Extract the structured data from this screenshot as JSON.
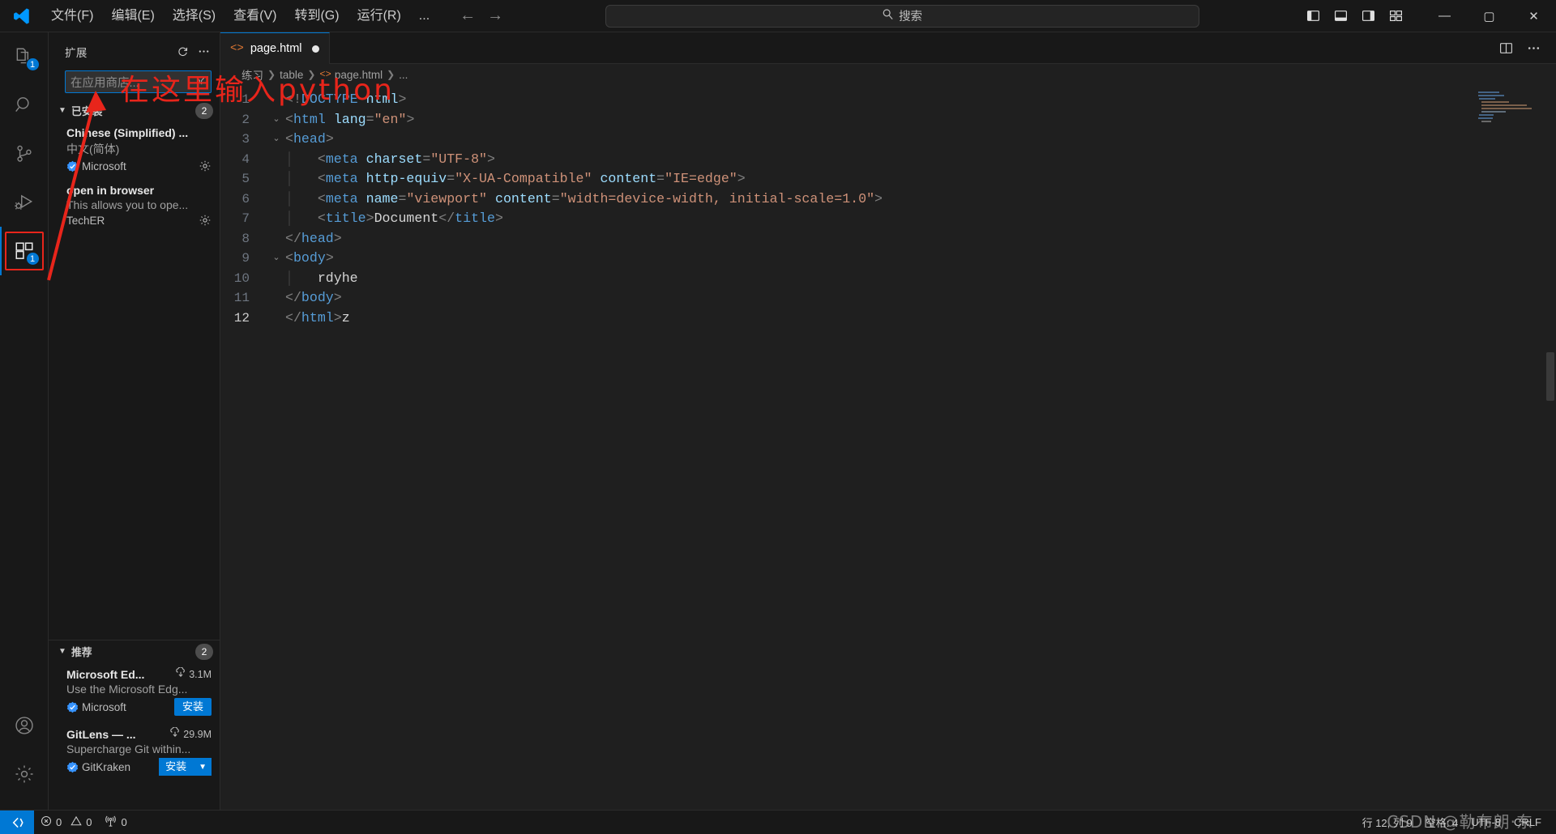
{
  "titlebar": {
    "logo_icon": "vscode-logo-icon",
    "menus": [
      "文件(F)",
      "编辑(E)",
      "选择(S)",
      "查看(V)",
      "转到(G)",
      "运行(R)",
      "..."
    ],
    "nav_back_icon": "arrow-left-icon",
    "nav_forward_icon": "arrow-right-icon",
    "search": {
      "icon": "search-icon",
      "text": "搜索",
      "value": ""
    },
    "layout_buttons": [
      {
        "name": "toggle-primary-sidebar",
        "icon": "layout-sidebar-left-icon"
      },
      {
        "name": "toggle-panel",
        "icon": "layout-panel-icon"
      },
      {
        "name": "toggle-secondary-sidebar",
        "icon": "layout-sidebar-right-icon"
      },
      {
        "name": "customize-layout",
        "icon": "layout-grid-icon"
      }
    ],
    "window_buttons": [
      {
        "name": "minimize-button",
        "glyph": "—"
      },
      {
        "name": "maximize-button",
        "glyph": "▢"
      },
      {
        "name": "close-button",
        "glyph": "✕"
      }
    ]
  },
  "activitybar": {
    "items": [
      {
        "name": "explorer",
        "icon": "files-icon",
        "badge": "1",
        "active": false
      },
      {
        "name": "search",
        "icon": "search-icon",
        "badge": "",
        "active": false
      },
      {
        "name": "source-control",
        "icon": "source-control-icon",
        "badge": "",
        "active": false
      },
      {
        "name": "run-and-debug",
        "icon": "debug-icon",
        "badge": "",
        "active": false
      },
      {
        "name": "extensions",
        "icon": "extensions-icon",
        "badge": "1",
        "active": true
      }
    ],
    "bottom": [
      {
        "name": "accounts",
        "icon": "account-icon"
      },
      {
        "name": "manage-settings",
        "icon": "gear-icon"
      }
    ]
  },
  "sidebar": {
    "title": "扩展",
    "refresh_icon": "refresh-icon",
    "more_icon": "ellipsis-icon",
    "search_placeholder": "在应用商店...",
    "search_value": "",
    "clear_icon": "clear-filter-icon",
    "sections": [
      {
        "label": "已安装",
        "count": "2",
        "expanded": true,
        "extensions": [
          {
            "name": "Chinese (Simplified) ...",
            "description": "中文(简体)",
            "publisher": "Microsoft",
            "verified": true,
            "installs": "",
            "action": "gear",
            "action_label": ""
          },
          {
            "name": "open in browser",
            "description": "This allows you to ope...",
            "publisher": "TechER",
            "verified": false,
            "installs": "",
            "action": "gear",
            "action_label": ""
          }
        ]
      },
      {
        "label": "推荐",
        "count": "2",
        "expanded": true,
        "extensions": [
          {
            "name": "Microsoft Ed...",
            "description": "Use the Microsoft Edg...",
            "publisher": "Microsoft",
            "verified": true,
            "installs": "3.1M",
            "action": "install",
            "action_label": "安装"
          },
          {
            "name": "GitLens — ...",
            "description": "Supercharge Git within...",
            "publisher": "GitKraken",
            "verified": true,
            "installs": "29.9M",
            "action": "install-split",
            "action_label": "安装"
          }
        ]
      }
    ]
  },
  "editor": {
    "tab": {
      "label": "page.html",
      "icon": "html-file-icon",
      "modified": true
    },
    "tab_actions": [
      {
        "name": "split-editor-right",
        "icon": "split-editor-icon"
      },
      {
        "name": "more-actions",
        "icon": "ellipsis-icon"
      }
    ],
    "breadcrumb": [
      "练习",
      "table",
      "page.html",
      "..."
    ],
    "code_lines": [
      {
        "n": "1",
        "fold": "",
        "indent": 0,
        "tokens": [
          {
            "c": "t-punct",
            "t": "<!"
          },
          {
            "c": "t-doctype",
            "t": "DOCTYPE"
          },
          {
            "c": "t-text",
            "t": " "
          },
          {
            "c": "t-attr",
            "t": "html"
          },
          {
            "c": "t-punct",
            "t": ">"
          }
        ]
      },
      {
        "n": "2",
        "fold": "v",
        "indent": 0,
        "tokens": [
          {
            "c": "t-punct",
            "t": "<"
          },
          {
            "c": "t-tag",
            "t": "html"
          },
          {
            "c": "t-text",
            "t": " "
          },
          {
            "c": "t-attr",
            "t": "lang"
          },
          {
            "c": "t-punct",
            "t": "="
          },
          {
            "c": "t-str",
            "t": "\"en\""
          },
          {
            "c": "t-punct",
            "t": ">"
          }
        ]
      },
      {
        "n": "3",
        "fold": "v",
        "indent": 0,
        "tokens": [
          {
            "c": "t-punct",
            "t": "<"
          },
          {
            "c": "t-tag",
            "t": "head"
          },
          {
            "c": "t-punct",
            "t": ">"
          }
        ]
      },
      {
        "n": "4",
        "fold": "",
        "indent": 1,
        "tokens": [
          {
            "c": "t-punct",
            "t": "<"
          },
          {
            "c": "t-tag",
            "t": "meta"
          },
          {
            "c": "t-text",
            "t": " "
          },
          {
            "c": "t-attr",
            "t": "charset"
          },
          {
            "c": "t-punct",
            "t": "="
          },
          {
            "c": "t-str",
            "t": "\"UTF-8\""
          },
          {
            "c": "t-punct",
            "t": ">"
          }
        ]
      },
      {
        "n": "5",
        "fold": "",
        "indent": 1,
        "tokens": [
          {
            "c": "t-punct",
            "t": "<"
          },
          {
            "c": "t-tag",
            "t": "meta"
          },
          {
            "c": "t-text",
            "t": " "
          },
          {
            "c": "t-attr",
            "t": "http-equiv"
          },
          {
            "c": "t-punct",
            "t": "="
          },
          {
            "c": "t-str",
            "t": "\"X-UA-Compatible\""
          },
          {
            "c": "t-text",
            "t": " "
          },
          {
            "c": "t-attr",
            "t": "content"
          },
          {
            "c": "t-punct",
            "t": "="
          },
          {
            "c": "t-str",
            "t": "\"IE=edge\""
          },
          {
            "c": "t-punct",
            "t": ">"
          }
        ]
      },
      {
        "n": "6",
        "fold": "",
        "indent": 1,
        "tokens": [
          {
            "c": "t-punct",
            "t": "<"
          },
          {
            "c": "t-tag",
            "t": "meta"
          },
          {
            "c": "t-text",
            "t": " "
          },
          {
            "c": "t-attr",
            "t": "name"
          },
          {
            "c": "t-punct",
            "t": "="
          },
          {
            "c": "t-str",
            "t": "\"viewport\""
          },
          {
            "c": "t-text",
            "t": " "
          },
          {
            "c": "t-attr",
            "t": "content"
          },
          {
            "c": "t-punct",
            "t": "="
          },
          {
            "c": "t-str",
            "t": "\"width=device-width, initial-scale=1.0\""
          },
          {
            "c": "t-punct",
            "t": ">"
          }
        ]
      },
      {
        "n": "7",
        "fold": "",
        "indent": 1,
        "tokens": [
          {
            "c": "t-punct",
            "t": "<"
          },
          {
            "c": "t-tag",
            "t": "title"
          },
          {
            "c": "t-punct",
            "t": ">"
          },
          {
            "c": "t-text",
            "t": "Document"
          },
          {
            "c": "t-punct",
            "t": "</"
          },
          {
            "c": "t-tag",
            "t": "title"
          },
          {
            "c": "t-punct",
            "t": ">"
          }
        ]
      },
      {
        "n": "8",
        "fold": "",
        "indent": 0,
        "tokens": [
          {
            "c": "t-punct",
            "t": "</"
          },
          {
            "c": "t-tag",
            "t": "head"
          },
          {
            "c": "t-punct",
            "t": ">"
          }
        ]
      },
      {
        "n": "9",
        "fold": "v",
        "indent": 0,
        "tokens": [
          {
            "c": "t-punct",
            "t": "<"
          },
          {
            "c": "t-tag",
            "t": "body"
          },
          {
            "c": "t-punct",
            "t": ">"
          }
        ]
      },
      {
        "n": "10",
        "fold": "",
        "indent": 1,
        "tokens": [
          {
            "c": "t-text",
            "t": "rdyhe"
          }
        ]
      },
      {
        "n": "11",
        "fold": "",
        "indent": 0,
        "tokens": [
          {
            "c": "t-punct",
            "t": "</"
          },
          {
            "c": "t-tag",
            "t": "body"
          },
          {
            "c": "t-punct",
            "t": ">"
          }
        ]
      },
      {
        "n": "12",
        "fold": "",
        "indent": 0,
        "tokens": [
          {
            "c": "t-punct",
            "t": "</"
          },
          {
            "c": "t-tag",
            "t": "html"
          },
          {
            "c": "t-punct",
            "t": ">"
          },
          {
            "c": "t-text",
            "t": "z"
          }
        ]
      }
    ],
    "current_line": "12"
  },
  "statusbar": {
    "remote_icon": "remote-window-icon",
    "errors": {
      "icon": "error-icon",
      "value": "0"
    },
    "warnings": {
      "icon": "warning-icon",
      "value": "0"
    },
    "ports": {
      "icon": "radio-tower-icon",
      "value": "0"
    },
    "cursor_position": "行 12, 列 9",
    "indentation": "空格: 4",
    "encoding": "UTF-8",
    "eol": "CRLF"
  },
  "annotations": {
    "red_text": "在这里输入python",
    "arrow_color": "#e8251b",
    "highlight_color": "#e8251b",
    "watermark": "CSDN @勒布朗·东"
  }
}
